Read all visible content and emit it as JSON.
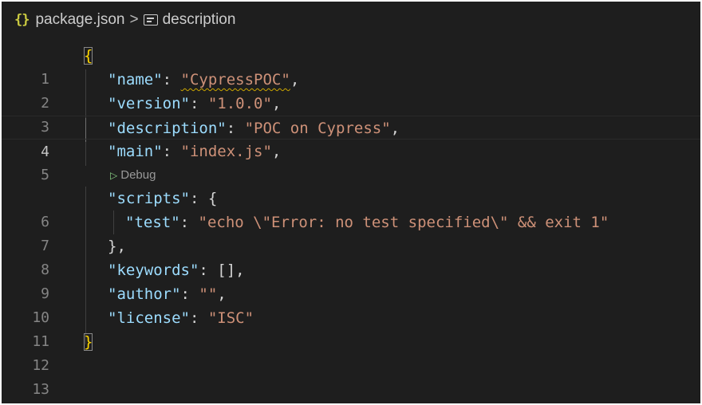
{
  "breadcrumb": {
    "file_icon": "{}",
    "file": "package.json",
    "separator": ">",
    "symbol": "description"
  },
  "lines": [
    {
      "n": "1"
    },
    {
      "n": "2",
      "key": "\"name\"",
      "value": "\"CypressPOC\""
    },
    {
      "n": "3",
      "key": "\"version\"",
      "value": "\"1.0.0\""
    },
    {
      "n": "4",
      "key": "\"description\"",
      "value": "\"POC on Cypress\""
    },
    {
      "n": "5",
      "key": "\"main\"",
      "value": "\"index.js\""
    },
    {
      "n": "6",
      "key": "\"scripts\""
    },
    {
      "n": "7",
      "key": "\"test\"",
      "value": "\"echo \\\"Error: no test specified\\\" && exit 1\""
    },
    {
      "n": "8"
    },
    {
      "n": "9",
      "key": "\"keywords\""
    },
    {
      "n": "10",
      "key": "\"author\"",
      "value": "\"\""
    },
    {
      "n": "11",
      "key": "\"license\"",
      "value": "\"ISC\""
    },
    {
      "n": "12"
    },
    {
      "n": "13"
    }
  ],
  "codelens": {
    "icon": "play-icon",
    "label": "Debug"
  },
  "colors": {
    "background": "#1e1e1e",
    "key": "#9cdcfe",
    "string": "#ce9178",
    "line_number": "#858585",
    "json_icon": "#cbcb41"
  }
}
